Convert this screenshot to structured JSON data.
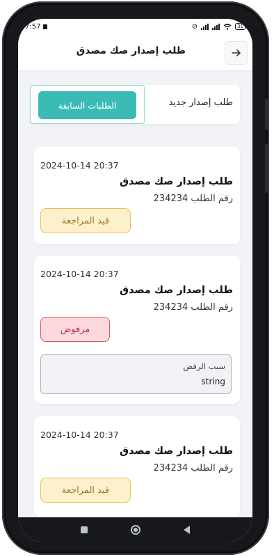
{
  "status_bar": {
    "time": "7:57",
    "battery": "31"
  },
  "header": {
    "title": "طلب إصدار صك مصدق",
    "back_icon": "arrow-right-icon"
  },
  "tabs": {
    "new_request": "طلب إصدار جديد",
    "previous_requests": "الطلبات السابقة"
  },
  "requests": [
    {
      "date": "2024-10-14 20:37",
      "title": "طلب إصدار صك مصدق",
      "order_number": "رقم الطلب 234234",
      "status": "قيد المراجعة"
    },
    {
      "date": "2024-10-14 20:37",
      "title": "طلب إصدار صك مصدق",
      "order_number": "رقم الطلب 234234",
      "status": "مرفوض",
      "reason_label": "سبب الرفض",
      "reason_value": "string"
    },
    {
      "date": "2024-10-14 20:37",
      "title": "طلب إصدار صك مصدق",
      "order_number": "رقم الطلب 234234",
      "status": "قيد المراجعة"
    }
  ],
  "colors": {
    "accent": "#3bbbb6",
    "review_bg": "#fdf1cd",
    "review_border": "#e9c25a",
    "reject_bg": "#fbd9dd",
    "reject_border": "#d55a68"
  }
}
